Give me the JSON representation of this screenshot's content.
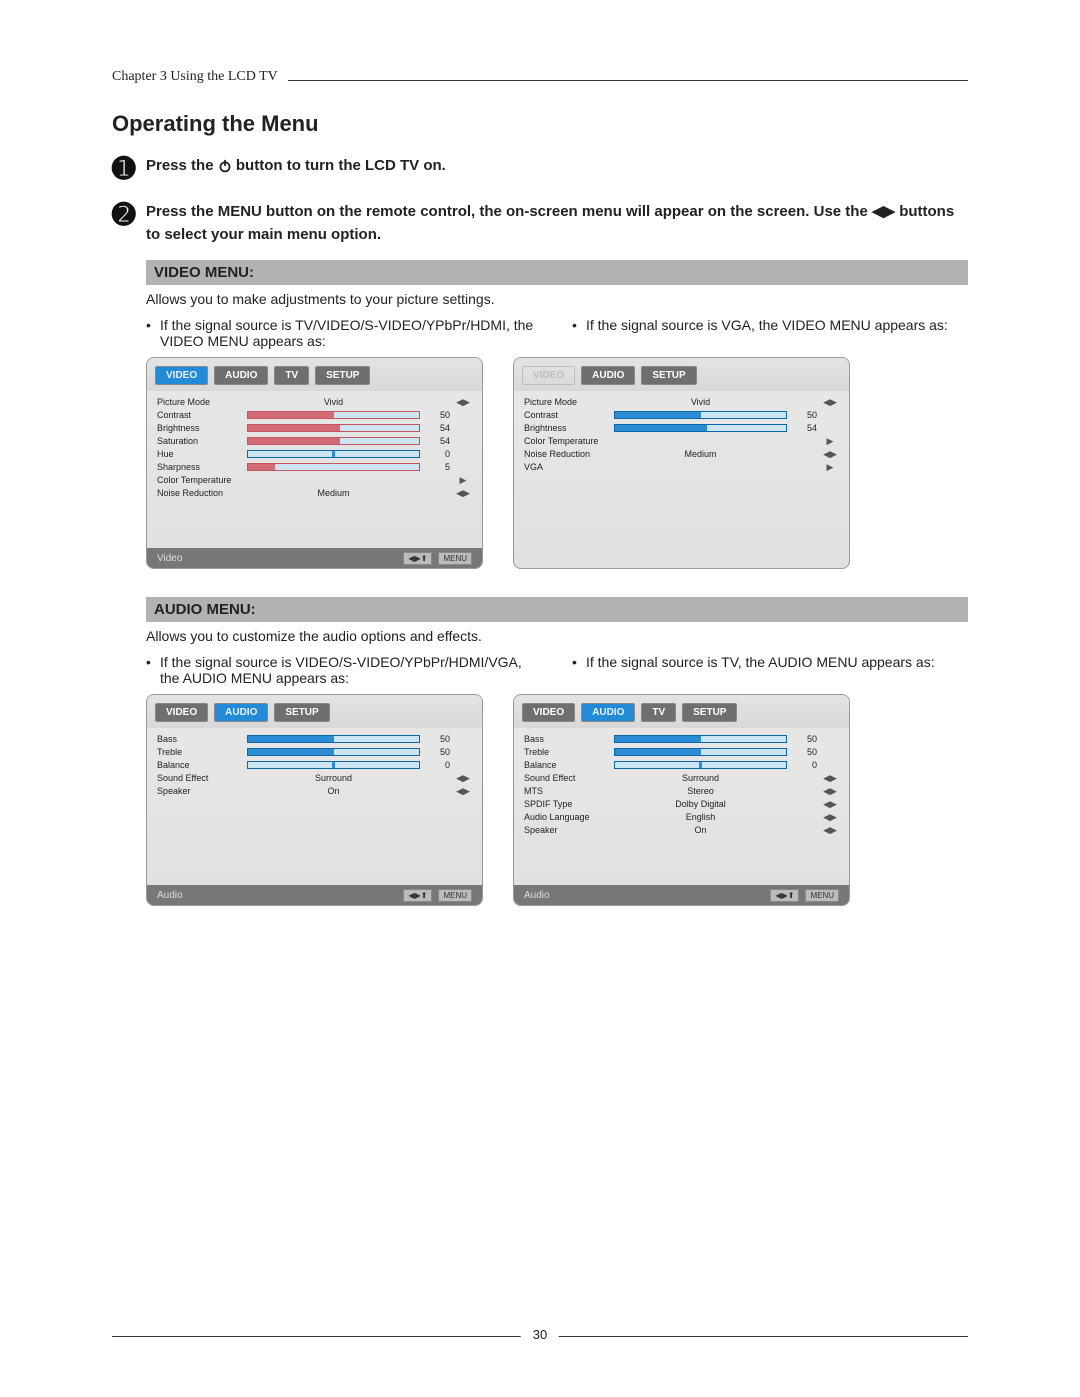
{
  "header": {
    "chapter_line": "Chapter 3 Using the LCD TV"
  },
  "section_title": "Operating the Menu",
  "steps": {
    "s1_num": "➊",
    "s1_pre": "Press the ",
    "s1_post": " button to turn the LCD TV on.",
    "s2_num": "➋",
    "s2_text": "Press the MENU button on the remote control, the on-screen menu will appear on the screen. Use the ◀▶ buttons to select your main menu option."
  },
  "video": {
    "title": "VIDEO MENU:",
    "desc": "Allows you to make adjustments to your picture settings.",
    "cap_left": "If the signal source is TV/VIDEO/S-VIDEO/YPbPr/HDMI, the VIDEO MENU appears as:",
    "cap_right": "If the signal source is VGA, the VIDEO MENU appears as:"
  },
  "video_panel_left": {
    "tabs": [
      "VIDEO",
      "AUDIO",
      "TV",
      "SETUP"
    ],
    "active": 0,
    "ghost": false,
    "rows": [
      {
        "label": "Picture Mode",
        "type": "value",
        "value": "Vivid",
        "arrow": "◀▶"
      },
      {
        "label": "Contrast",
        "type": "slider",
        "pink": true,
        "value": 50,
        "valText": "50"
      },
      {
        "label": "Brightness",
        "type": "slider",
        "pink": true,
        "value": 54,
        "valText": "54"
      },
      {
        "label": "Saturation",
        "type": "slider",
        "pink": true,
        "value": 54,
        "valText": "54"
      },
      {
        "label": "Hue",
        "type": "slider",
        "pink": false,
        "value": 50,
        "valText": "0",
        "center": true
      },
      {
        "label": "Sharpness",
        "type": "slider",
        "pink": true,
        "value": 16,
        "valText": "5"
      },
      {
        "label": "Color Temperature",
        "type": "arrow",
        "value": "",
        "arrow": "▶"
      },
      {
        "label": "Noise Reduction",
        "type": "value",
        "value": "Medium",
        "arrow": "◀▶"
      }
    ],
    "bottom_name": "Video",
    "hints": [
      "◀▶⬆",
      "MENU"
    ]
  },
  "video_panel_right": {
    "tabs": [
      "VIDEO",
      "AUDIO",
      "SETUP"
    ],
    "active": 0,
    "ghost": true,
    "rows": [
      {
        "label": "Picture Mode",
        "type": "value",
        "value": "Vivid",
        "arrow": "◀▶"
      },
      {
        "label": "Contrast",
        "type": "slider",
        "pink": false,
        "value": 50,
        "valText": "50"
      },
      {
        "label": "Brightness",
        "type": "slider",
        "pink": false,
        "value": 54,
        "valText": "54"
      },
      {
        "label": "Color Temperature",
        "type": "arrow",
        "value": "",
        "arrow": "▶"
      },
      {
        "label": "Noise Reduction",
        "type": "value",
        "value": "Medium",
        "arrow": "◀▶"
      },
      {
        "label": "VGA",
        "type": "arrow",
        "value": "",
        "arrow": "▶"
      }
    ],
    "bottom_name": ""
  },
  "audio": {
    "title": "AUDIO MENU:",
    "desc": "Allows you to customize the audio options and effects.",
    "cap_left": "If the signal source is VIDEO/S-VIDEO/YPbPr/HDMI/VGA, the AUDIO MENU appears as:",
    "cap_right": "If the signal source is TV, the AUDIO MENU appears as:"
  },
  "audio_panel_left": {
    "tabs": [
      "VIDEO",
      "AUDIO",
      "SETUP"
    ],
    "active": 1,
    "ghost": false,
    "rows": [
      {
        "label": "Bass",
        "type": "slider",
        "pink": false,
        "value": 50,
        "valText": "50"
      },
      {
        "label": "Treble",
        "type": "slider",
        "pink": false,
        "value": 50,
        "valText": "50"
      },
      {
        "label": "Balance",
        "type": "slider",
        "pink": false,
        "value": 50,
        "valText": "0",
        "center": true
      },
      {
        "label": "Sound Effect",
        "type": "value",
        "value": "Surround",
        "arrow": "◀▶"
      },
      {
        "label": "Speaker",
        "type": "value",
        "value": "On",
        "arrow": "◀▶"
      }
    ],
    "bottom_name": "Audio",
    "hints": [
      "◀▶⬆",
      "MENU"
    ]
  },
  "audio_panel_right": {
    "tabs": [
      "VIDEO",
      "AUDIO",
      "TV",
      "SETUP"
    ],
    "active": 1,
    "ghost": false,
    "rows": [
      {
        "label": "Bass",
        "type": "slider",
        "pink": false,
        "value": 50,
        "valText": "50"
      },
      {
        "label": "Treble",
        "type": "slider",
        "pink": false,
        "value": 50,
        "valText": "50"
      },
      {
        "label": "Balance",
        "type": "slider",
        "pink": false,
        "value": 50,
        "valText": "0",
        "center": true
      },
      {
        "label": "Sound Effect",
        "type": "value",
        "value": "Surround",
        "arrow": "◀▶"
      },
      {
        "label": "MTS",
        "type": "value",
        "value": "Stereo",
        "arrow": "◀▶"
      },
      {
        "label": "SPDIF Type",
        "type": "value",
        "value": "Dolby Digital",
        "arrow": "◀▶"
      },
      {
        "label": "Audio Language",
        "type": "value",
        "value": "English",
        "arrow": "◀▶"
      },
      {
        "label": "Speaker",
        "type": "value",
        "value": "On",
        "arrow": "◀▶"
      }
    ],
    "bottom_name": "Audio",
    "hints": [
      "◀▶⬆",
      "MENU"
    ]
  },
  "footer": {
    "page_num": "30"
  }
}
